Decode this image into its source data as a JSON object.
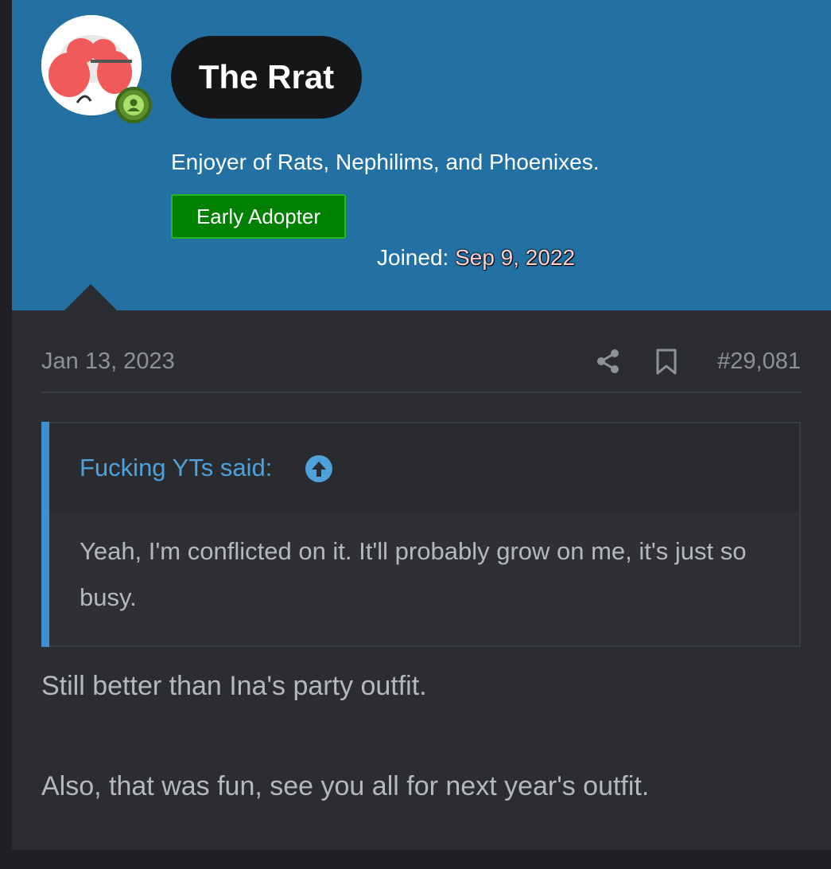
{
  "user": {
    "name": "The Rrat",
    "title": "Enjoyer of Rats, Nephilims, and Phoenixes.",
    "banner": "Early Adopter",
    "joined_label": "Joined:",
    "joined_date": "Sep 9, 2022",
    "avatar_icon": "rat-avatar",
    "status_icon": "online-user-icon"
  },
  "post": {
    "date": "Jan 13, 2023",
    "number": "#29,081",
    "share_icon": "share-icon",
    "bookmark_icon": "bookmark-icon"
  },
  "quote": {
    "author": "Fucking YTs said:",
    "body": "Yeah, I'm conflicted on it. It'll probably grow on me, it's just so busy."
  },
  "message": {
    "lines": [
      "Still better than Ina's party outfit.",
      "Also, that was fun, see you all for next year's outfit."
    ]
  },
  "colors": {
    "header": "#2371a3",
    "post_bg": "#2b2d31",
    "quote_accent": "#3d8fd1",
    "banner_green": "#008000"
  }
}
